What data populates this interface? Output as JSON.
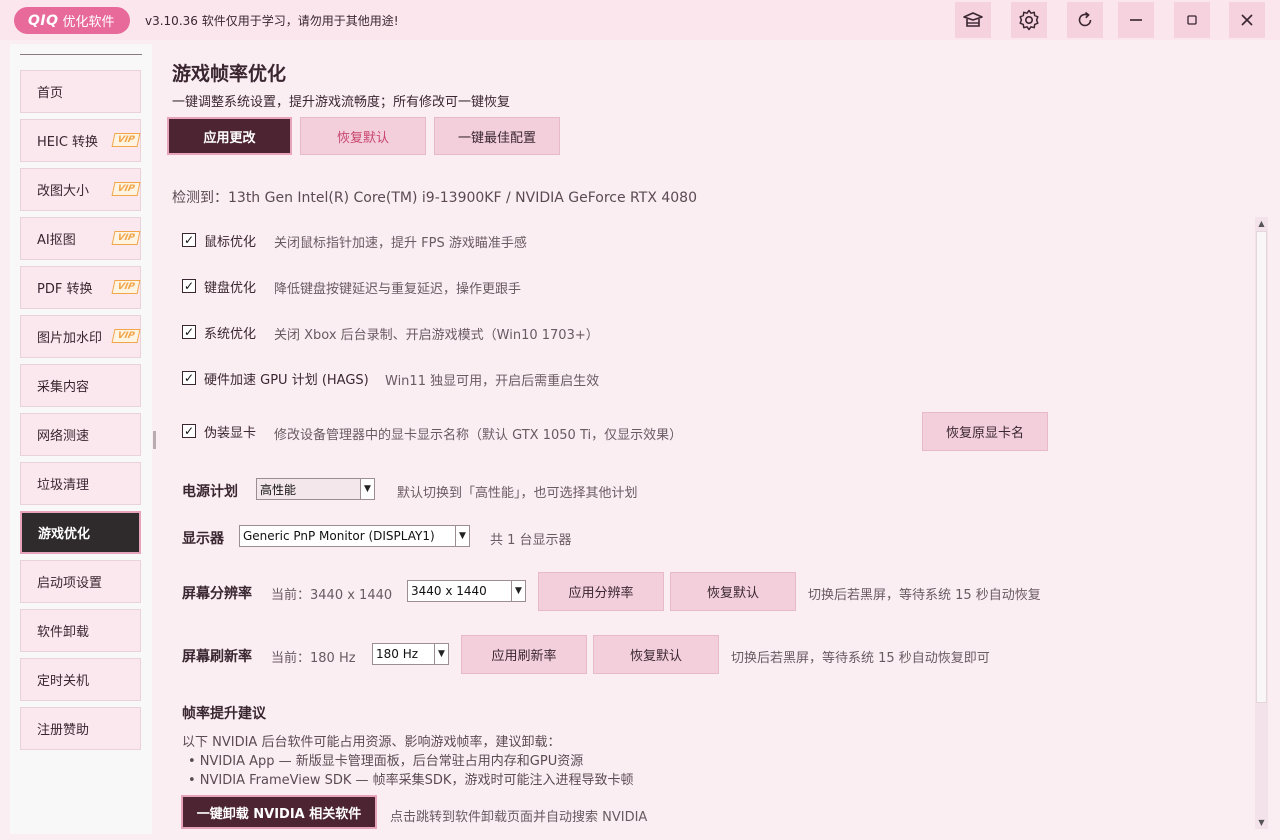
{
  "titlebar": {
    "brand": "QIQ",
    "app_name": "优化软件",
    "version_note": "v3.10.36 软件仅用于学习，请勿用于其他用途!",
    "icons": [
      "hat-icon",
      "gear-icon",
      "refresh-icon",
      "minimize-icon",
      "restore-icon",
      "close-icon"
    ]
  },
  "sidebar": {
    "items": [
      {
        "label": "首页"
      },
      {
        "label": "HEIC 转换",
        "badge": "VIP"
      },
      {
        "label": "改图大小",
        "badge": "VIP"
      },
      {
        "label": "AI抠图",
        "badge": "VIP"
      },
      {
        "label": "PDF 转换",
        "badge": "VIP"
      },
      {
        "label": "图片加水印",
        "badge": "VIP"
      },
      {
        "label": "采集内容"
      },
      {
        "label": "网络测速"
      },
      {
        "label": "垃圾清理"
      },
      {
        "label": "游戏优化",
        "active": true
      },
      {
        "label": "启动项设置"
      },
      {
        "label": "软件卸载"
      },
      {
        "label": "定时关机"
      },
      {
        "label": "注册赞助"
      }
    ]
  },
  "main": {
    "title": "游戏帧率优化",
    "subtitle": "一键调整系统设置，提升游戏流畅度；所有修改可一键恢复",
    "buttons": {
      "apply": "应用更改",
      "restore_default": "恢复默认",
      "best_config": "一键最佳配置"
    },
    "detected": "检测到：13th Gen Intel(R) Core(TM) i9-13900KF  /  NVIDIA GeForce RTX 4080",
    "options": [
      {
        "label": "鼠标优化",
        "desc": "关闭鼠标指针加速，提升 FPS 游戏瞄准手感",
        "checked": true
      },
      {
        "label": "键盘优化",
        "desc": "降低键盘按键延迟与重复延迟，操作更跟手",
        "checked": true
      },
      {
        "label": "系统优化",
        "desc": "关闭 Xbox 后台录制、开启游戏模式（Win10 1703+）",
        "checked": true
      },
      {
        "label": "硬件加速 GPU 计划 (HAGS)",
        "desc": "Win11 独显可用，开启后需重启生效",
        "checked": true
      },
      {
        "label": "伪装显卡",
        "desc": "修改设备管理器中的显卡显示名称（默认 GTX 1050 Ti，仅显示效果）",
        "checked": true
      }
    ],
    "restore_gpu_name": "恢复原显卡名",
    "power": {
      "label": "电源计划",
      "value": "高性能",
      "note": "默认切换到「高性能」，也可选择其他计划"
    },
    "display": {
      "label": "显示器",
      "value": "Generic PnP Monitor (DISPLAY1)",
      "note": "共 1 台显示器"
    },
    "resolution": {
      "label": "屏幕分辨率",
      "current": "当前：3440 x 1440",
      "value": "3440 x 1440",
      "apply": "应用分辨率",
      "restore": "恢复默认",
      "note": "切换后若黑屏，等待系统 15 秒自动恢复"
    },
    "refresh": {
      "label": "屏幕刷新率",
      "current": "当前：180 Hz",
      "value": "180 Hz",
      "apply": "应用刷新率",
      "restore": "恢复默认",
      "note": "切换后若黑屏，等待系统 15 秒自动恢复即可"
    },
    "suggestion": {
      "title": "帧率提升建议",
      "intro": "以下 NVIDIA 后台软件可能占用资源、影响游戏帧率，建议卸载：",
      "items": [
        "• NVIDIA App — 新版显卡管理面板，后台常驻占用内存和GPU资源",
        "• NVIDIA FrameView SDK — 帧率采集SDK，游戏时可能注入进程导致卡顿"
      ],
      "uninstall_button": "一键卸载 NVIDIA 相关软件",
      "uninstall_note": "点击跳转到软件卸载页面并自动搜索 NVIDIA"
    }
  }
}
